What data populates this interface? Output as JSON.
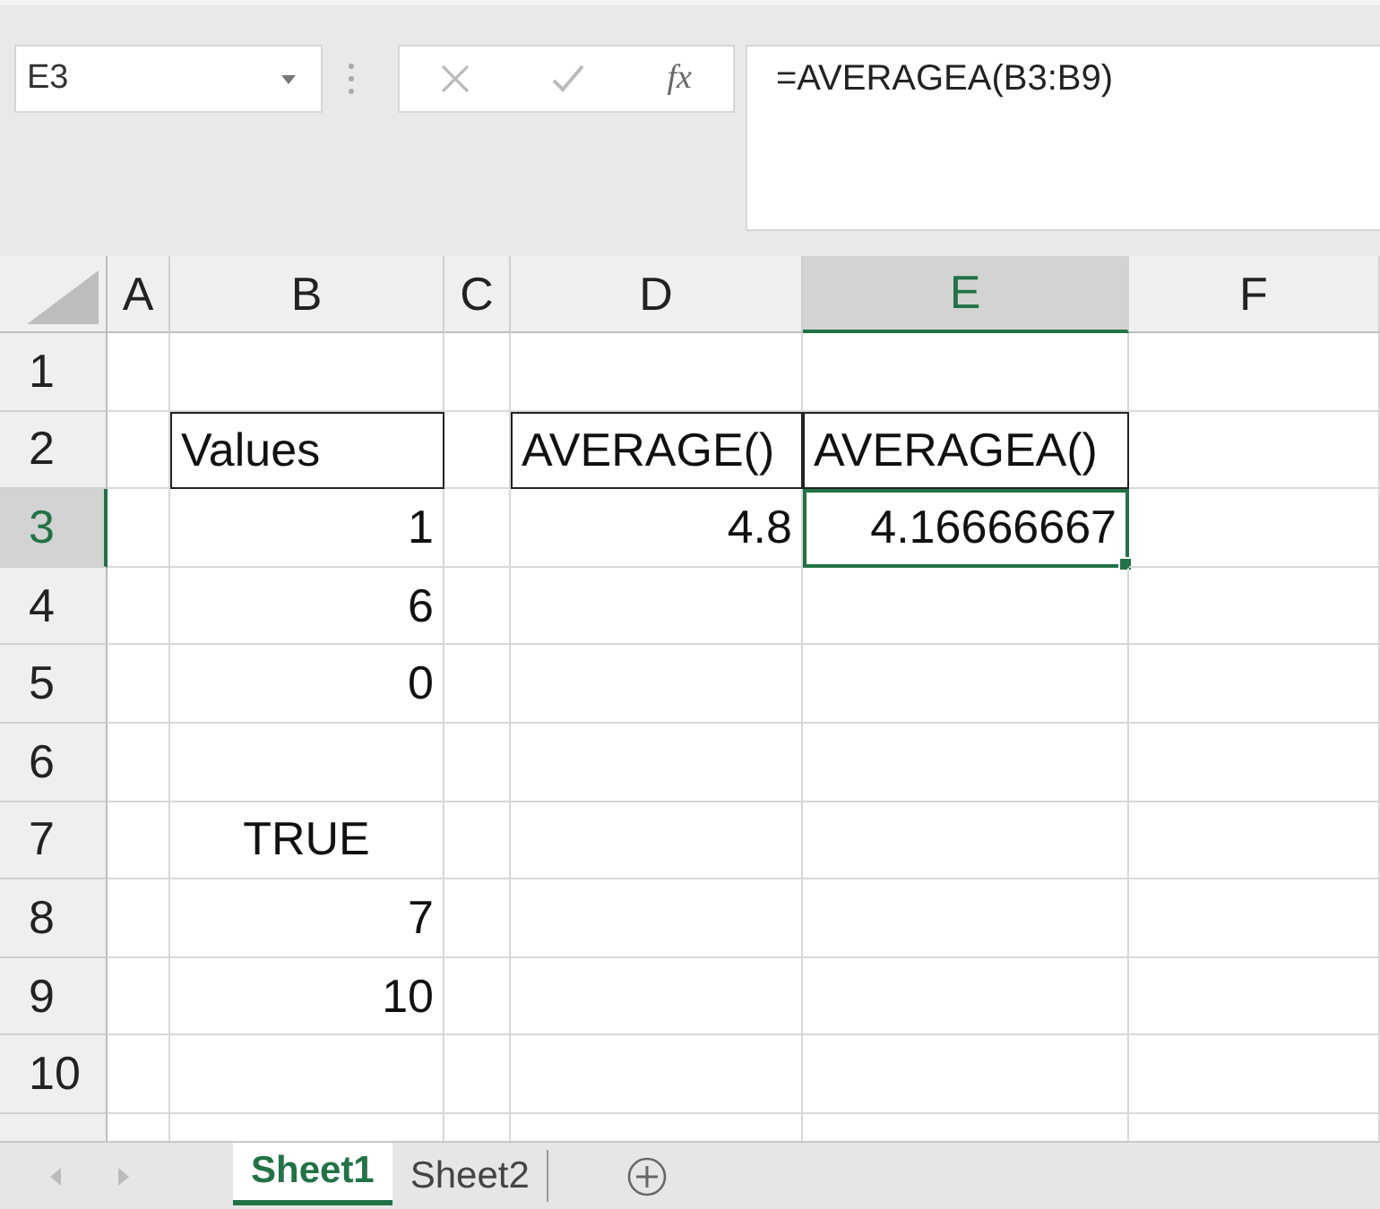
{
  "name_box": {
    "value": "E3"
  },
  "formula_bar": {
    "insert_function_label": "fx",
    "formula": "=AVERAGEA(B3:B9)"
  },
  "columns": [
    {
      "label": "A",
      "selected": false
    },
    {
      "label": "B",
      "selected": false
    },
    {
      "label": "C",
      "selected": false
    },
    {
      "label": "D",
      "selected": false
    },
    {
      "label": "E",
      "selected": true
    },
    {
      "label": "F",
      "selected": false
    }
  ],
  "rows": [
    {
      "label": "1",
      "selected": false,
      "cells": [
        {
          "bordered": false,
          "selected": false
        },
        {
          "bordered": false,
          "selected": false
        },
        {
          "bordered": false,
          "selected": false
        },
        {
          "bordered": false,
          "selected": false
        },
        {
          "bordered": false,
          "selected": false
        },
        {
          "bordered": false,
          "selected": false
        }
      ]
    },
    {
      "label": "2",
      "selected": false,
      "cells": [
        {
          "bordered": false,
          "selected": false
        },
        {
          "kind": "text",
          "text": "Values",
          "bordered": true,
          "selected": false
        },
        {
          "bordered": false,
          "selected": false
        },
        {
          "kind": "text",
          "text": "AVERAGE()",
          "bordered": true,
          "selected": false
        },
        {
          "kind": "text",
          "text": "AVERAGEA()",
          "bordered": true,
          "selected": false
        },
        {
          "bordered": false,
          "selected": false
        }
      ]
    },
    {
      "label": "3",
      "selected": true,
      "cells": [
        {
          "bordered": false,
          "selected": false
        },
        {
          "kind": "number",
          "text": "1",
          "bordered": false,
          "selected": false
        },
        {
          "bordered": false,
          "selected": false
        },
        {
          "kind": "number",
          "text": "4.8",
          "bordered": false,
          "selected": false
        },
        {
          "kind": "number",
          "text": "4.16666667",
          "bordered": false,
          "selected": true
        },
        {
          "bordered": false,
          "selected": false
        }
      ]
    },
    {
      "label": "4",
      "selected": false,
      "cells": [
        {
          "bordered": false,
          "selected": false
        },
        {
          "kind": "number",
          "text": "6",
          "bordered": false,
          "selected": false
        },
        {
          "bordered": false,
          "selected": false
        },
        {
          "bordered": false,
          "selected": false
        },
        {
          "bordered": false,
          "selected": false
        },
        {
          "bordered": false,
          "selected": false
        }
      ]
    },
    {
      "label": "5",
      "selected": false,
      "cells": [
        {
          "bordered": false,
          "selected": false
        },
        {
          "kind": "number",
          "text": "0",
          "bordered": false,
          "selected": false
        },
        {
          "bordered": false,
          "selected": false
        },
        {
          "bordered": false,
          "selected": false
        },
        {
          "bordered": false,
          "selected": false
        },
        {
          "bordered": false,
          "selected": false
        }
      ]
    },
    {
      "label": "6",
      "selected": false,
      "cells": [
        {
          "bordered": false,
          "selected": false
        },
        {
          "bordered": false,
          "selected": false
        },
        {
          "bordered": false,
          "selected": false
        },
        {
          "bordered": false,
          "selected": false
        },
        {
          "bordered": false,
          "selected": false
        },
        {
          "bordered": false,
          "selected": false
        }
      ]
    },
    {
      "label": "7",
      "selected": false,
      "cells": [
        {
          "bordered": false,
          "selected": false
        },
        {
          "kind": "boolean",
          "text": "TRUE",
          "bordered": false,
          "selected": false
        },
        {
          "bordered": false,
          "selected": false
        },
        {
          "bordered": false,
          "selected": false
        },
        {
          "bordered": false,
          "selected": false
        },
        {
          "bordered": false,
          "selected": false
        }
      ]
    },
    {
      "label": "8",
      "selected": false,
      "cells": [
        {
          "bordered": false,
          "selected": false
        },
        {
          "kind": "number",
          "text": "7",
          "bordered": false,
          "selected": false
        },
        {
          "bordered": false,
          "selected": false
        },
        {
          "bordered": false,
          "selected": false
        },
        {
          "bordered": false,
          "selected": false
        },
        {
          "bordered": false,
          "selected": false
        }
      ]
    },
    {
      "label": "9",
      "selected": false,
      "cells": [
        {
          "bordered": false,
          "selected": false
        },
        {
          "kind": "number",
          "text": "10",
          "bordered": false,
          "selected": false
        },
        {
          "bordered": false,
          "selected": false
        },
        {
          "bordered": false,
          "selected": false
        },
        {
          "bordered": false,
          "selected": false
        },
        {
          "bordered": false,
          "selected": false
        }
      ]
    },
    {
      "label": "10",
      "selected": false,
      "cells": [
        {
          "bordered": false,
          "selected": false
        },
        {
          "bordered": false,
          "selected": false
        },
        {
          "bordered": false,
          "selected": false
        },
        {
          "bordered": false,
          "selected": false
        },
        {
          "bordered": false,
          "selected": false
        },
        {
          "bordered": false,
          "selected": false
        }
      ]
    }
  ],
  "sheets": [
    {
      "label": "Sheet1",
      "selected": true
    },
    {
      "label": "Sheet2",
      "selected": false
    }
  ]
}
